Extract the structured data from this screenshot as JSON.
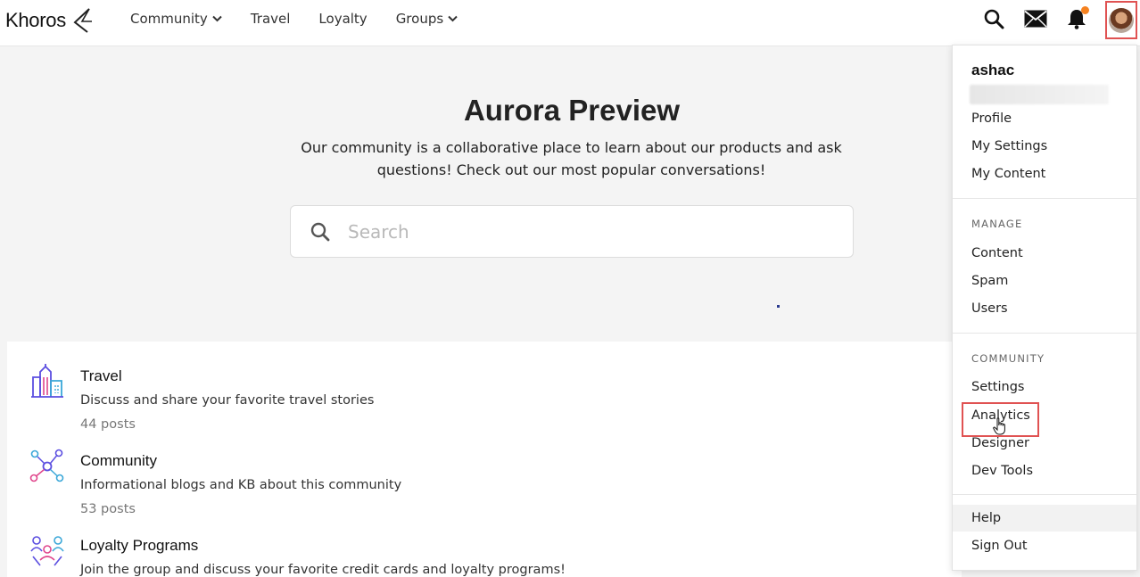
{
  "topbar": {
    "logo_text": "Khoros",
    "nav": [
      {
        "label": "Community",
        "has_dropdown": true
      },
      {
        "label": "Travel",
        "has_dropdown": false
      },
      {
        "label": "Loyalty",
        "has_dropdown": false
      },
      {
        "label": "Groups",
        "has_dropdown": true
      }
    ],
    "icons": [
      "search-icon",
      "mail-icon",
      "bell-icon",
      "avatar"
    ],
    "notification_dot_color": "#f58220"
  },
  "hero": {
    "title": "Aurora Preview",
    "subtitle": "Our community is a collaborative place to learn about our products and ask questions! Check out our most popular conversations!",
    "search_placeholder": "Search"
  },
  "places": [
    {
      "title": "Travel",
      "description": "Discuss and share your favorite travel stories",
      "count": "44 posts",
      "icon": "city-buildings-icon"
    },
    {
      "title": "Community",
      "description": "Informational blogs and KB about this community",
      "count": "53 posts",
      "icon": "network-nodes-icon"
    },
    {
      "title": "Loyalty Programs",
      "description": "Join the group and discuss your favorite credit cards and loyalty programs!",
      "icon": "people-group-icon"
    }
  ],
  "user_menu": {
    "username": "ashac",
    "account_items": [
      "Profile",
      "My Settings",
      "My Content"
    ],
    "manage_heading": "MANAGE",
    "manage_items": [
      "Content",
      "Spam",
      "Users"
    ],
    "community_heading": "COMMUNITY",
    "community_items": [
      "Settings",
      "Analytics",
      "Designer",
      "Dev Tools"
    ],
    "footer_items": [
      "Help",
      "Sign Out"
    ],
    "highlight_color": "#e05252"
  }
}
